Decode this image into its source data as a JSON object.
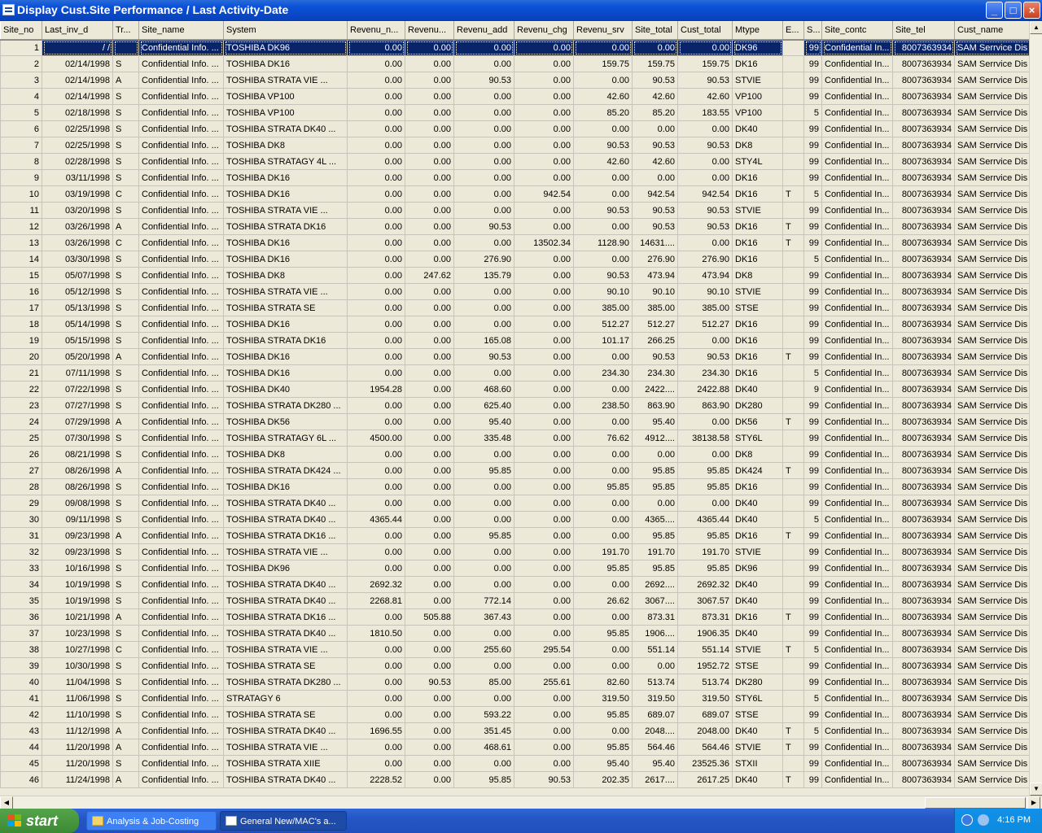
{
  "window": {
    "title": "Display Cust.Site Performance / Last Activity-Date"
  },
  "columns": [
    "Site_no",
    "Last_inv_d",
    "Tr...",
    "Site_name",
    "System",
    "Revenu_n...",
    "Revenu...",
    "Revenu_add",
    "Revenu_chg",
    "Revenu_srv",
    "Site_total",
    "Cust_total",
    "Mtype",
    "E...",
    "S...",
    "Site_contc",
    "Site_tel",
    "Cust_name"
  ],
  "rows": [
    [
      "1",
      "  /  /",
      "",
      "Confidential Info.  ...",
      "TOSHIBA DK96",
      "0.00",
      "0.00",
      "0.00",
      "0.00",
      "0.00",
      "0.00",
      "0.00",
      "DK96",
      "",
      "99",
      "Confidential In...",
      "8007363934",
      "SAM Serrvice Dis"
    ],
    [
      "2",
      "02/14/1998",
      "S",
      "Confidential Info.  ...",
      "TOSHIBA DK16",
      "0.00",
      "0.00",
      "0.00",
      "0.00",
      "159.75",
      "159.75",
      "159.75",
      "DK16",
      "",
      "99",
      "Confidential In...",
      "8007363934",
      "SAM Serrvice Dis"
    ],
    [
      "3",
      "02/14/1998",
      "A",
      "Confidential Info.  ...",
      "TOSHIBA STRATA VIE    ...",
      "0.00",
      "0.00",
      "90.53",
      "0.00",
      "0.00",
      "90.53",
      "90.53",
      "STVIE",
      "",
      "99",
      "Confidential In...",
      "8007363934",
      "SAM Serrvice Dis"
    ],
    [
      "4",
      "02/14/1998",
      "S",
      "Confidential Info.  ...",
      "TOSHIBA VP100",
      "0.00",
      "0.00",
      "0.00",
      "0.00",
      "42.60",
      "42.60",
      "42.60",
      "VP100",
      "",
      "99",
      "Confidential In...",
      "8007363934",
      "SAM Serrvice Dis"
    ],
    [
      "5",
      "02/18/1998",
      "S",
      "Confidential Info.  ...",
      "TOSHIBA VP100",
      "0.00",
      "0.00",
      "0.00",
      "0.00",
      "85.20",
      "85.20",
      "183.55",
      "VP100",
      "",
      "5",
      "Confidential In...",
      "8007363934",
      "SAM Serrvice Dis"
    ],
    [
      "6",
      "02/25/1998",
      "S",
      "Confidential Info.  ...",
      "TOSHIBA STRATA DK40    ...",
      "0.00",
      "0.00",
      "0.00",
      "0.00",
      "0.00",
      "0.00",
      "0.00",
      "DK40",
      "",
      "99",
      "Confidential In...",
      "8007363934",
      "SAM Serrvice Dis"
    ],
    [
      "7",
      "02/25/1998",
      "S",
      "Confidential Info.  ...",
      "TOSHIBA DK8",
      "0.00",
      "0.00",
      "0.00",
      "0.00",
      "90.53",
      "90.53",
      "90.53",
      "DK8",
      "",
      "99",
      "Confidential In...",
      "8007363934",
      "SAM Serrvice Dis"
    ],
    [
      "8",
      "02/28/1998",
      "S",
      "Confidential Info.  ...",
      "TOSHIBA STRATAGY 4L    ...",
      "0.00",
      "0.00",
      "0.00",
      "0.00",
      "42.60",
      "42.60",
      "0.00",
      "STY4L",
      "",
      "99",
      "Confidential In...",
      "8007363934",
      "SAM Serrvice Dis"
    ],
    [
      "9",
      "03/11/1998",
      "S",
      "Confidential Info.  ...",
      "TOSHIBA DK16",
      "0.00",
      "0.00",
      "0.00",
      "0.00",
      "0.00",
      "0.00",
      "0.00",
      "DK16",
      "",
      "99",
      "Confidential In...",
      "8007363934",
      "SAM Serrvice Dis"
    ],
    [
      "10",
      "03/19/1998",
      "C",
      "Confidential Info.  ...",
      "TOSHIBA DK16",
      "0.00",
      "0.00",
      "0.00",
      "942.54",
      "0.00",
      "942.54",
      "942.54",
      "DK16",
      "T",
      "5",
      "Confidential In...",
      "8007363934",
      "SAM Serrvice Dis"
    ],
    [
      "11",
      "03/20/1998",
      "S",
      "Confidential Info.  ...",
      "TOSHIBA STRATA VIE    ...",
      "0.00",
      "0.00",
      "0.00",
      "0.00",
      "90.53",
      "90.53",
      "90.53",
      "STVIE",
      "",
      "99",
      "Confidential In...",
      "8007363934",
      "SAM Serrvice Dis"
    ],
    [
      "12",
      "03/26/1998",
      "A",
      "Confidential Info.  ...",
      "TOSHIBA STRATA DK16",
      "0.00",
      "0.00",
      "90.53",
      "0.00",
      "0.00",
      "90.53",
      "90.53",
      "DK16",
      "T",
      "99",
      "Confidential In...",
      "8007363934",
      "SAM Serrvice Dis"
    ],
    [
      "13",
      "03/26/1998",
      "C",
      "Confidential Info.  ...",
      "TOSHIBA DK16",
      "0.00",
      "0.00",
      "0.00",
      "13502.34",
      "1128.90",
      "14631....",
      "0.00",
      "DK16",
      "T",
      "99",
      "Confidential In...",
      "8007363934",
      "SAM Serrvice Dis"
    ],
    [
      "14",
      "03/30/1998",
      "S",
      "Confidential Info.  ...",
      "TOSHIBA DK16",
      "0.00",
      "0.00",
      "276.90",
      "0.00",
      "0.00",
      "276.90",
      "276.90",
      "DK16",
      "",
      "5",
      "Confidential In...",
      "8007363934",
      "SAM Serrvice Dis"
    ],
    [
      "15",
      "05/07/1998",
      "S",
      "Confidential Info.  ...",
      "TOSHIBA DK8",
      "0.00",
      "247.62",
      "135.79",
      "0.00",
      "90.53",
      "473.94",
      "473.94",
      "DK8",
      "",
      "99",
      "Confidential In...",
      "8007363934",
      "SAM Serrvice Dis"
    ],
    [
      "16",
      "05/12/1998",
      "S",
      "Confidential Info.  ...",
      "TOSHIBA STRATA VIE    ...",
      "0.00",
      "0.00",
      "0.00",
      "0.00",
      "90.10",
      "90.10",
      "90.10",
      "STVIE",
      "",
      "99",
      "Confidential In...",
      "8007363934",
      "SAM Serrvice Dis"
    ],
    [
      "17",
      "05/13/1998",
      "S",
      "Confidential Info.  ...",
      "TOSHIBA STRATA SE",
      "0.00",
      "0.00",
      "0.00",
      "0.00",
      "385.00",
      "385.00",
      "385.00",
      "STSE",
      "",
      "99",
      "Confidential In...",
      "8007363934",
      "SAM Serrvice Dis"
    ],
    [
      "18",
      "05/14/1998",
      "S",
      "Confidential Info.  ...",
      "TOSHIBA DK16",
      "0.00",
      "0.00",
      "0.00",
      "0.00",
      "512.27",
      "512.27",
      "512.27",
      "DK16",
      "",
      "99",
      "Confidential In...",
      "8007363934",
      "SAM Serrvice Dis"
    ],
    [
      "19",
      "05/15/1998",
      "S",
      "Confidential Info.  ...",
      "TOSHIBA STRATA DK16",
      "0.00",
      "0.00",
      "165.08",
      "0.00",
      "101.17",
      "266.25",
      "0.00",
      "DK16",
      "",
      "99",
      "Confidential In...",
      "8007363934",
      "SAM Serrvice Dis"
    ],
    [
      "20",
      "05/20/1998",
      "A",
      "Confidential Info.  ...",
      "TOSHIBA DK16",
      "0.00",
      "0.00",
      "90.53",
      "0.00",
      "0.00",
      "90.53",
      "90.53",
      "DK16",
      "T",
      "99",
      "Confidential In...",
      "8007363934",
      "SAM Serrvice Dis"
    ],
    [
      "21",
      "07/11/1998",
      "S",
      "Confidential Info.  ...",
      "TOSHIBA DK16",
      "0.00",
      "0.00",
      "0.00",
      "0.00",
      "234.30",
      "234.30",
      "234.30",
      "DK16",
      "",
      "5",
      "Confidential In...",
      "8007363934",
      "SAM Serrvice Dis"
    ],
    [
      "22",
      "07/22/1998",
      "S",
      "Confidential Info.  ...",
      "TOSHIBA DK40",
      "1954.28",
      "0.00",
      "468.60",
      "0.00",
      "0.00",
      "2422....",
      "2422.88",
      "DK40",
      "",
      "9",
      "Confidential In...",
      "8007363934",
      "SAM Serrvice Dis"
    ],
    [
      "23",
      "07/27/1998",
      "S",
      "Confidential Info.  ...",
      "TOSHIBA STRATA DK280    ...",
      "0.00",
      "0.00",
      "625.40",
      "0.00",
      "238.50",
      "863.90",
      "863.90",
      "DK280",
      "",
      "99",
      "Confidential In...",
      "8007363934",
      "SAM Serrvice Dis"
    ],
    [
      "24",
      "07/29/1998",
      "A",
      "Confidential Info.  ...",
      "TOSHIBA DK56",
      "0.00",
      "0.00",
      "95.40",
      "0.00",
      "0.00",
      "95.40",
      "0.00",
      "DK56",
      "T",
      "99",
      "Confidential In...",
      "8007363934",
      "SAM Serrvice Dis"
    ],
    [
      "25",
      "07/30/1998",
      "S",
      "Confidential Info.  ...",
      "TOSHIBA STRATAGY 6L    ...",
      "4500.00",
      "0.00",
      "335.48",
      "0.00",
      "76.62",
      "4912....",
      "38138.58",
      "STY6L",
      "",
      "99",
      "Confidential In...",
      "8007363934",
      "SAM Serrvice Dis"
    ],
    [
      "26",
      "08/21/1998",
      "S",
      "Confidential Info.  ...",
      "TOSHIBA DK8",
      "0.00",
      "0.00",
      "0.00",
      "0.00",
      "0.00",
      "0.00",
      "0.00",
      "DK8",
      "",
      "99",
      "Confidential In...",
      "8007363934",
      "SAM Serrvice Dis"
    ],
    [
      "27",
      "08/26/1998",
      "A",
      "Confidential Info.  ...",
      "TOSHIBA STRATA DK424    ...",
      "0.00",
      "0.00",
      "95.85",
      "0.00",
      "0.00",
      "95.85",
      "95.85",
      "DK424",
      "T",
      "99",
      "Confidential In...",
      "8007363934",
      "SAM Serrvice Dis"
    ],
    [
      "28",
      "08/26/1998",
      "S",
      "Confidential Info.  ...",
      "TOSHIBA DK16",
      "0.00",
      "0.00",
      "0.00",
      "0.00",
      "95.85",
      "95.85",
      "95.85",
      "DK16",
      "",
      "99",
      "Confidential In...",
      "8007363934",
      "SAM Serrvice Dis"
    ],
    [
      "29",
      "09/08/1998",
      "S",
      "Confidential Info.  ...",
      "TOSHIBA STRATA DK40    ...",
      "0.00",
      "0.00",
      "0.00",
      "0.00",
      "0.00",
      "0.00",
      "0.00",
      "DK40",
      "",
      "99",
      "Confidential In...",
      "8007363934",
      "SAM Serrvice Dis"
    ],
    [
      "30",
      "09/11/1998",
      "S",
      "Confidential Info.  ...",
      "TOSHIBA STRATA DK40    ...",
      "4365.44",
      "0.00",
      "0.00",
      "0.00",
      "0.00",
      "4365....",
      "4365.44",
      "DK40",
      "",
      "5",
      "Confidential In...",
      "8007363934",
      "SAM Serrvice Dis"
    ],
    [
      "31",
      "09/23/1998",
      "A",
      "Confidential Info.  ...",
      "TOSHIBA STRATA DK16    ...",
      "0.00",
      "0.00",
      "95.85",
      "0.00",
      "0.00",
      "95.85",
      "95.85",
      "DK16",
      "T",
      "99",
      "Confidential In...",
      "8007363934",
      "SAM Serrvice Dis"
    ],
    [
      "32",
      "09/23/1998",
      "S",
      "Confidential Info.  ...",
      "TOSHIBA STRATA VIE    ...",
      "0.00",
      "0.00",
      "0.00",
      "0.00",
      "191.70",
      "191.70",
      "191.70",
      "STVIE",
      "",
      "99",
      "Confidential In...",
      "8007363934",
      "SAM Serrvice Dis"
    ],
    [
      "33",
      "10/16/1998",
      "S",
      "Confidential Info.  ...",
      "TOSHIBA DK96",
      "0.00",
      "0.00",
      "0.00",
      "0.00",
      "95.85",
      "95.85",
      "95.85",
      "DK96",
      "",
      "99",
      "Confidential In...",
      "8007363934",
      "SAM Serrvice Dis"
    ],
    [
      "34",
      "10/19/1998",
      "S",
      "Confidential Info.  ...",
      "TOSHIBA STRATA DK40    ...",
      "2692.32",
      "0.00",
      "0.00",
      "0.00",
      "0.00",
      "2692....",
      "2692.32",
      "DK40",
      "",
      "99",
      "Confidential In...",
      "8007363934",
      "SAM Serrvice Dis"
    ],
    [
      "35",
      "10/19/1998",
      "S",
      "Confidential Info.  ...",
      "TOSHIBA STRATA DK40    ...",
      "2268.81",
      "0.00",
      "772.14",
      "0.00",
      "26.62",
      "3067....",
      "3067.57",
      "DK40",
      "",
      "99",
      "Confidential In...",
      "8007363934",
      "SAM Serrvice Dis"
    ],
    [
      "36",
      "10/21/1998",
      "A",
      "Confidential Info.  ...",
      "TOSHIBA STRATA DK16    ...",
      "0.00",
      "505.88",
      "367.43",
      "0.00",
      "0.00",
      "873.31",
      "873.31",
      "DK16",
      "T",
      "99",
      "Confidential In...",
      "8007363934",
      "SAM Serrvice Dis"
    ],
    [
      "37",
      "10/23/1998",
      "S",
      "Confidential Info.  ...",
      "TOSHIBA STRATA DK40    ...",
      "1810.50",
      "0.00",
      "0.00",
      "0.00",
      "95.85",
      "1906....",
      "1906.35",
      "DK40",
      "",
      "99",
      "Confidential In...",
      "8007363934",
      "SAM Serrvice Dis"
    ],
    [
      "38",
      "10/27/1998",
      "C",
      "Confidential Info.  ...",
      "TOSHIBA STRATA VIE    ...",
      "0.00",
      "0.00",
      "255.60",
      "295.54",
      "0.00",
      "551.14",
      "551.14",
      "STVIE",
      "T",
      "5",
      "Confidential In...",
      "8007363934",
      "SAM Serrvice Dis"
    ],
    [
      "39",
      "10/30/1998",
      "S",
      "Confidential Info.  ...",
      "TOSHIBA STRATA SE",
      "0.00",
      "0.00",
      "0.00",
      "0.00",
      "0.00",
      "0.00",
      "1952.72",
      "STSE",
      "",
      "99",
      "Confidential In...",
      "8007363934",
      "SAM Serrvice Dis"
    ],
    [
      "40",
      "11/04/1998",
      "S",
      "Confidential Info.  ...",
      "TOSHIBA STRATA DK280    ...",
      "0.00",
      "90.53",
      "85.00",
      "255.61",
      "82.60",
      "513.74",
      "513.74",
      "DK280",
      "",
      "99",
      "Confidential In...",
      "8007363934",
      "SAM Serrvice Dis"
    ],
    [
      "41",
      "11/06/1998",
      "S",
      "Confidential Info.  ...",
      "STRATAGY 6",
      "0.00",
      "0.00",
      "0.00",
      "0.00",
      "319.50",
      "319.50",
      "319.50",
      "STY6L",
      "",
      "5",
      "Confidential In...",
      "8007363934",
      "SAM Serrvice Dis"
    ],
    [
      "42",
      "11/10/1998",
      "S",
      "Confidential Info.  ...",
      "TOSHIBA STRATA SE",
      "0.00",
      "0.00",
      "593.22",
      "0.00",
      "95.85",
      "689.07",
      "689.07",
      "STSE",
      "",
      "99",
      "Confidential In...",
      "8007363934",
      "SAM Serrvice Dis"
    ],
    [
      "43",
      "11/12/1998",
      "A",
      "Confidential Info.  ...",
      "TOSHIBA STRATA DK40    ...",
      "1696.55",
      "0.00",
      "351.45",
      "0.00",
      "0.00",
      "2048....",
      "2048.00",
      "DK40",
      "T",
      "5",
      "Confidential In...",
      "8007363934",
      "SAM Serrvice Dis"
    ],
    [
      "44",
      "11/20/1998",
      "A",
      "Confidential Info.  ...",
      "TOSHIBA STRATA VIE    ...",
      "0.00",
      "0.00",
      "468.61",
      "0.00",
      "95.85",
      "564.46",
      "564.46",
      "STVIE",
      "T",
      "99",
      "Confidential In...",
      "8007363934",
      "SAM Serrvice Dis"
    ],
    [
      "45",
      "11/20/1998",
      "S",
      "Confidential Info.  ...",
      "TOSHIBA STRATA XIIE",
      "0.00",
      "0.00",
      "0.00",
      "0.00",
      "95.40",
      "95.40",
      "23525.36",
      "STXII",
      "",
      "99",
      "Confidential In...",
      "8007363934",
      "SAM Serrvice Dis"
    ],
    [
      "46",
      "11/24/1998",
      "A",
      "Confidential Info.  ...",
      "TOSHIBA STRATA DK40    ...",
      "2228.52",
      "0.00",
      "95.85",
      "90.53",
      "202.35",
      "2617....",
      "2617.25",
      "DK40",
      "T",
      "99",
      "Confidential In...",
      "8007363934",
      "SAM Serrvice Dis"
    ]
  ],
  "taskbar": {
    "start_label": "start",
    "tasks": [
      "Analysis & Job-Costing",
      "General New/MAC's a..."
    ],
    "clock": "4:16 PM"
  },
  "colors": {
    "selection": "#0a246a",
    "titlebar": "#0b52d9",
    "taskbar": "#2456c4",
    "start": "#3c8a34"
  }
}
